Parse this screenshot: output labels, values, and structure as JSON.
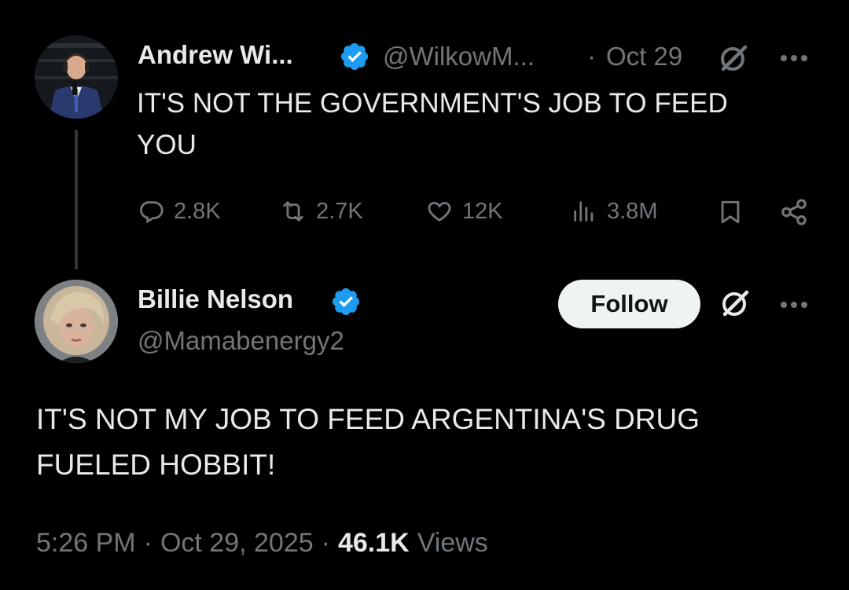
{
  "original_tweet": {
    "author_name": "Andrew Wi...",
    "handle": "@WilkowM...",
    "dot": "·",
    "date": "Oct 29",
    "text": "IT'S NOT THE GOVERNMENT'S JOB TO FEED YOU",
    "stats": {
      "replies": "2.8K",
      "reposts": "2.7K",
      "likes": "12K",
      "views": "3.8M"
    }
  },
  "reply_tweet": {
    "author_name": "Billie Nelson",
    "handle": "@Mamabenergy2",
    "follow_label": "Follow",
    "text": "IT'S NOT MY JOB TO FEED ARGENTINA'S DRUG FUELED HOBBIT!",
    "time": "5:26 PM",
    "date": "Oct 29, 2025",
    "sep1": "·",
    "sep2": "·",
    "views_count": "46.1K",
    "views_label": "Views"
  },
  "colors": {
    "background": "#000000",
    "text": "#e7e9ea",
    "muted": "#71767b",
    "verified": "#1d9bf0",
    "follow_bg": "#eff3f4"
  },
  "icons": [
    "verified-badge-icon",
    "grok-icon",
    "more-icon",
    "reply-icon",
    "repost-icon",
    "like-icon",
    "views-icon",
    "bookmark-icon",
    "share-icon"
  ]
}
